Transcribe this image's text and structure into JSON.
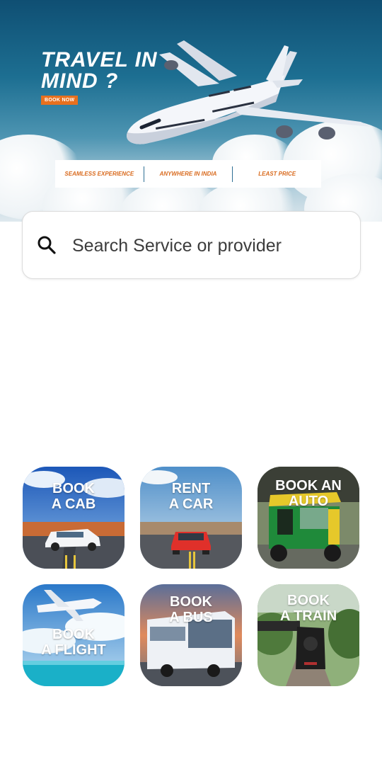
{
  "banner": {
    "title_line1": "TRAVEL IN",
    "title_line2": "MIND ?",
    "book_now": "BOOK NOW",
    "features": [
      "SEAMLESS EXPERIENCE",
      "ANYWHERE IN INDIA",
      "LEAST PRICE"
    ]
  },
  "search": {
    "placeholder": "Search Service or provider"
  },
  "services": [
    {
      "line1": "BOOK",
      "line2": "A CAB"
    },
    {
      "line1": "RENT",
      "line2": "A CAR"
    },
    {
      "line1": "BOOK AN",
      "line2": "AUTO"
    },
    {
      "line1": "BOOK",
      "line2": "A FLIGHT"
    },
    {
      "line1": "BOOK",
      "line2": "A BUS"
    },
    {
      "line1": "BOOK",
      "line2": "A TRAIN"
    }
  ],
  "colors": {
    "accent_orange": "#e8701e",
    "sky_blue": "#1d6f92"
  }
}
